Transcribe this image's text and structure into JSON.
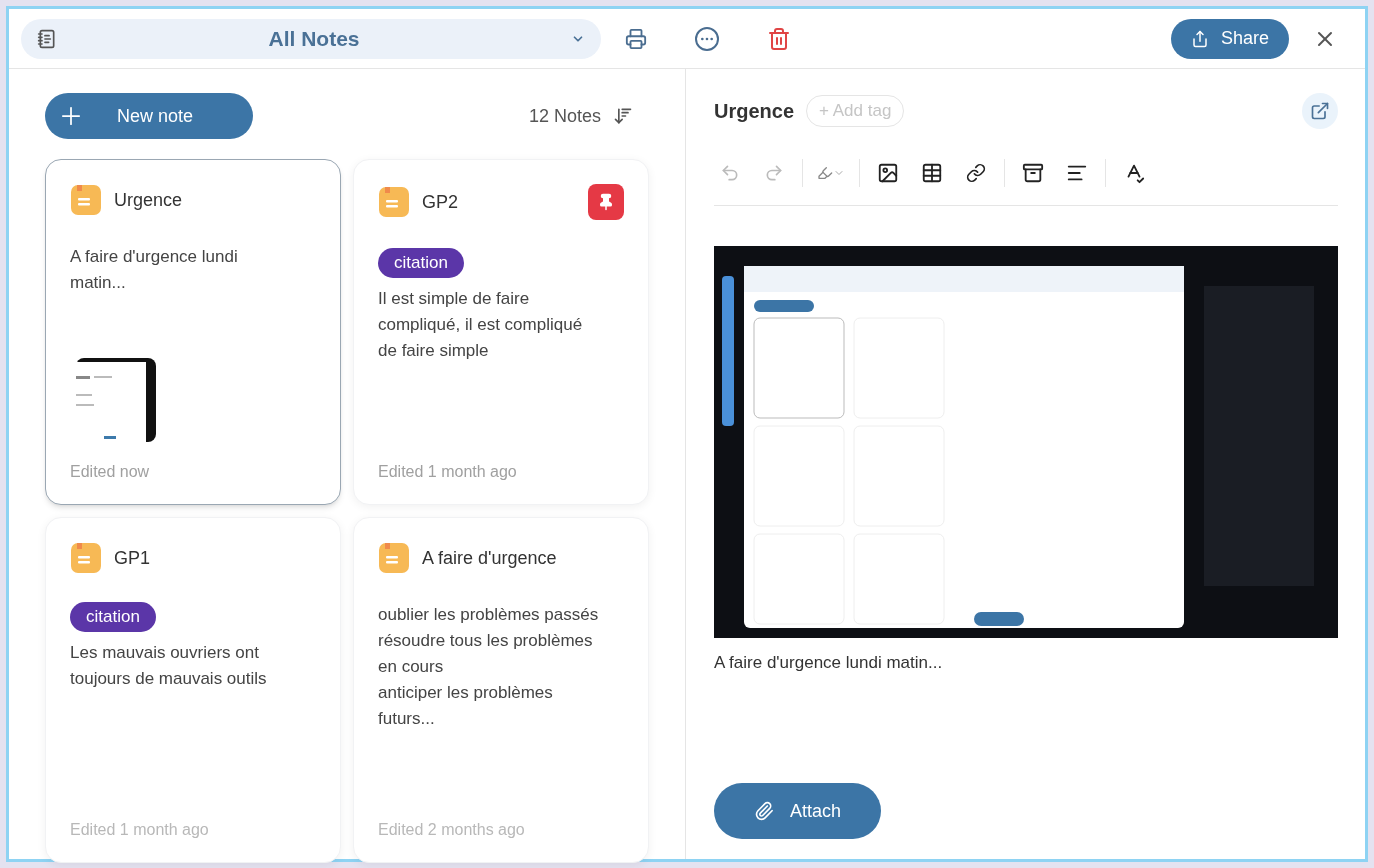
{
  "toolbar": {
    "view_selector": "All Notes"
  },
  "share_button": "Share",
  "new_note_button": "New note",
  "note_count": "12 Notes",
  "notes": [
    {
      "title": "Urgence",
      "selected": true,
      "pinned": false,
      "body": [
        "A faire d'urgence lundi matin..."
      ],
      "has_thumbnail": true,
      "edited": "Edited now"
    },
    {
      "title": "GP2",
      "selected": false,
      "pinned": true,
      "tag": "citation",
      "body": [
        "Il est simple de faire compliqué, il est compliqué de faire simple"
      ],
      "has_thumbnail": false,
      "edited": "Edited 1 month ago"
    },
    {
      "title": "GP1",
      "selected": false,
      "pinned": false,
      "tag": "citation",
      "body": [
        "Les mauvais ouvriers ont toujours de mauvais outils"
      ],
      "has_thumbnail": false,
      "edited": "Edited 1 month ago"
    },
    {
      "title": "A faire d'urgence",
      "selected": false,
      "pinned": false,
      "body": [
        "oublier les problèmes passés",
        "résoudre tous les problèmes en cours",
        "anticiper les problèmes futurs..."
      ],
      "has_thumbnail": false,
      "edited": "Edited 2 months ago"
    }
  ],
  "editor": {
    "title": "Urgence",
    "add_tag": "+ Add tag",
    "content": "A faire d'urgence lundi matin...",
    "attach_button": "Attach"
  }
}
